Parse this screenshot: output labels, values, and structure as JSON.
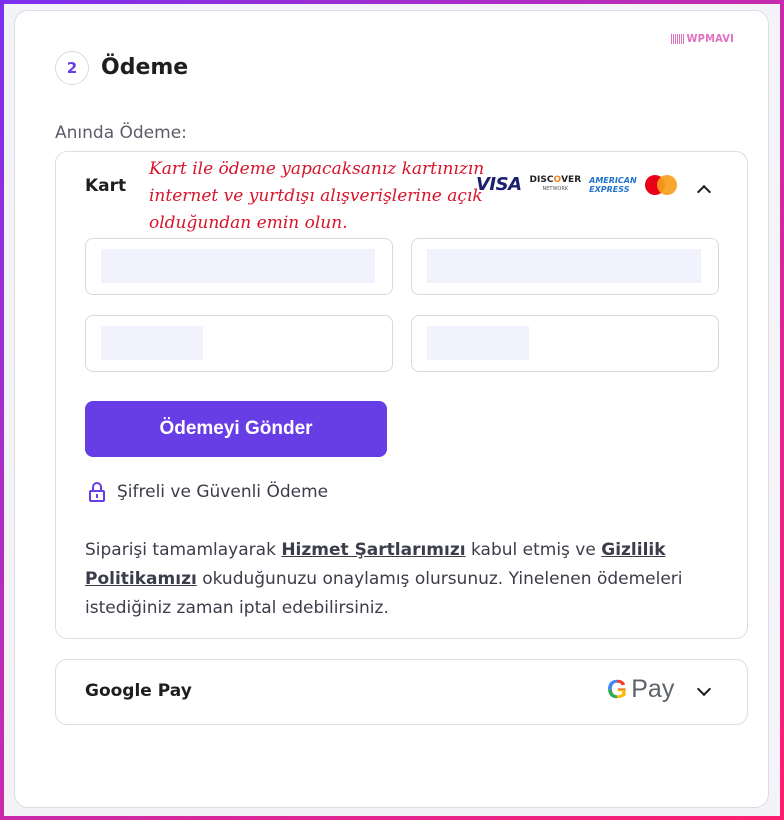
{
  "watermark": "WPMAVI",
  "step": {
    "number": "2",
    "title": "Ödeme"
  },
  "instant_payment_label": "Anında Ödeme:",
  "card_section": {
    "label": "Kart",
    "note": "Kart ile ödeme yapacaksanız kartınızın internet ve yurtdışı alışverişlerine açık olduğundan emin olun.",
    "brands": {
      "visa": "VISA",
      "discover_top": "DISC",
      "discover_o": "O",
      "discover_rest": "VER",
      "discover_sub": "NETWORK",
      "amex_1": "AMERICAN",
      "amex_2": "EXPRESS"
    },
    "submit_label": "Ödemeyi Gönder",
    "secure_label": "Şifreli ve Güvenli Ödeme",
    "terms": {
      "t1": "Siparişi tamamlayarak ",
      "link1": "Hizmet Şartlarımızı",
      "t2": " kabul etmiş ve ",
      "link2": "Gizlilik Politikamızı",
      "t3": " okuduğunuzu onaylamış olursunuz. Yinelenen ödemeleri istediğiniz zaman iptal edebilirsiniz."
    }
  },
  "google_pay": {
    "label": "Google Pay",
    "logo_g": "G",
    "logo_pay": "Pay"
  },
  "colors": {
    "accent": "#673de6",
    "note": "#d8142b"
  }
}
